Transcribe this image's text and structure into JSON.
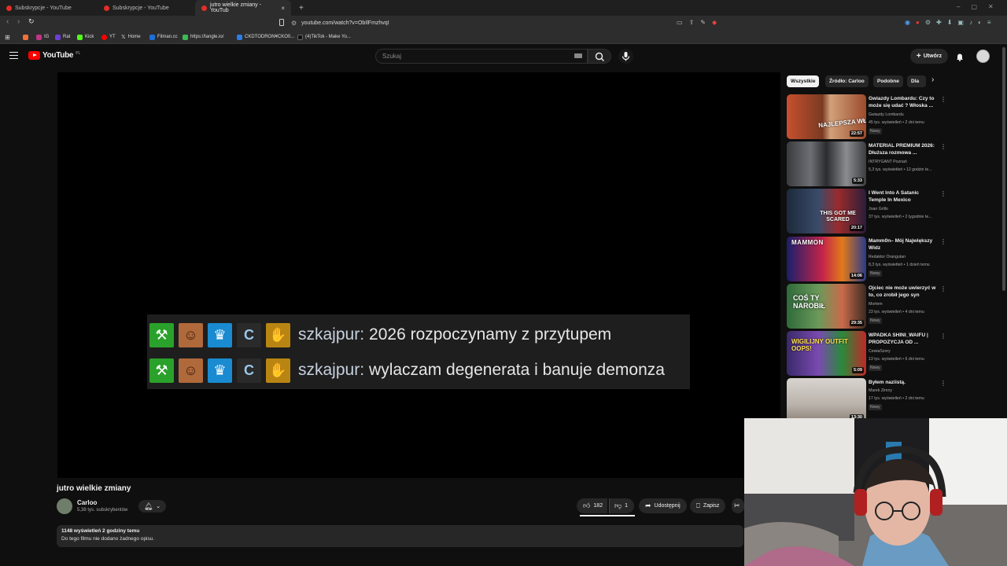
{
  "browser": {
    "tabs": [
      {
        "label": "Subskrypcje - YouTube"
      },
      {
        "label": "Subskrypcje - YouTube"
      },
      {
        "label": "jutro wielkie zmiany - YouTub"
      }
    ],
    "new_tab": "+",
    "url": "youtube.com/watch?v=ObIlFmzhvqI",
    "bookmarks": [
      "IG",
      "Rat",
      "Kick",
      "YT",
      "Home",
      "Filman.cc",
      "https://tangle.io/",
      "CKDTODRON¥CKO0...",
      "(4)TikTok - Make Yo..."
    ]
  },
  "youtube": {
    "logo_text": "YouTube",
    "logo_region": "PL",
    "search_placeholder": "Szukaj",
    "create_label": "Utwórz"
  },
  "video": {
    "title": "jutro wielkie zmiany",
    "chat_lines": [
      {
        "name": "szkajpur:",
        "message": "2026 rozpoczynamy z przytupem"
      },
      {
        "name": "szkajpur:",
        "message": "wylaczam degenerata i banuje demonza"
      }
    ],
    "channel": {
      "name": "Carloo",
      "subscribers": "5,38 tys. subskrybentów"
    },
    "likes": "182",
    "dislikes": "1",
    "share_label": "Udostępnij",
    "save_label": "Zapisz",
    "description": {
      "meta": "1148 wyświetleń  2 godziny temu",
      "body": "Do tego filmu nie dodano żadnego opisu."
    }
  },
  "chips": [
    "Wszystkie",
    "Źródło: Carloo",
    "Podobne",
    "Dla"
  ],
  "recommendations": [
    {
      "title": "Gwiazdy Lombardu: Czy to może się udać ? Włoska ...",
      "channel": "Gwiazdy Lombardu",
      "meta": "45 tys. wyświetleń • 2 dni temu",
      "badge": "Nowy",
      "duration": "22:57",
      "thumb_text": "NAJLEPSZA WŁOSKA PIZ"
    },
    {
      "title": "MATERIAL PREMIUM 2026: Dłuższa rozmowa ...",
      "channel": "INTRYGANT Poznań",
      "meta": "5,3 tys. wyświetleń • 12 godzin te...",
      "badge": "",
      "duration": "5:33",
      "thumb_text": ""
    },
    {
      "title": "I Went Into A Satanic Temple In Mexico",
      "channel": "Joan Grillo",
      "meta": "37 tys. wyświetleń • 2 tygodnie te...",
      "badge": "",
      "duration": "20:17",
      "thumb_text": "THIS GOT ME SCARED"
    },
    {
      "title": "Mamm0n– Mój Największy Widz",
      "channel": "Redaktor Orangutan",
      "meta": "8,3 tys. wyświetleń • 1 dzień temu",
      "badge": "Nowy",
      "duration": "14:06",
      "thumb_text": "MAMMON"
    },
    {
      "title": "Ojciec nie może uwierzyć w to, co zrobił jego syn",
      "channel": "Mortem",
      "meta": "23 tys. wyświetleń • 4 dni temu",
      "badge": "Nowy",
      "duration": "29:35",
      "thumb_text": "COŚ TY NAROBIŁ"
    },
    {
      "title": "WPADKA SHINI_WAIFU | PROPOZYCJA OD ...",
      "channel": "CewiaSzory",
      "meta": "13 tys. wyświetleń • 6 dni temu",
      "badge": "Nowy",
      "duration": "5:09",
      "thumb_text": "WIGILIJNY OUTFIT OOPS!"
    },
    {
      "title": "Byłem naziistą.",
      "channel": "Marek Zimny",
      "meta": "17 tys. wyświetleń • 2 dni temu",
      "badge": "Nowy",
      "duration": "13:30",
      "thumb_text": ""
    }
  ],
  "colors": {
    "background": "#0f0f0f",
    "brand_red": "#ff0000",
    "surface": "#272727"
  }
}
